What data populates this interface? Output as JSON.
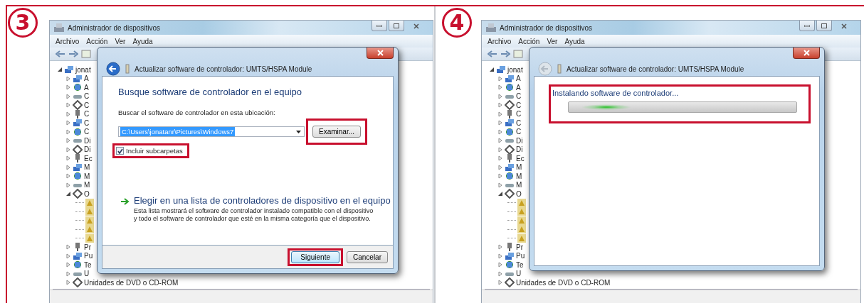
{
  "steps": [
    {
      "number": "3",
      "window": {
        "title": "Administrador de dispositivos",
        "menu": [
          "Archivo",
          "Acción",
          "Ver",
          "Ayuda"
        ],
        "tree": [
          {
            "label": "jonat",
            "expanded": true,
            "children": [
              {
                "label": "A",
                "expanded": false
              },
              {
                "label": "A",
                "expanded": false
              },
              {
                "label": "C",
                "expanded": false
              },
              {
                "label": "C",
                "expanded": false
              },
              {
                "label": "C",
                "expanded": false
              },
              {
                "label": "C",
                "expanded": false
              },
              {
                "label": "C",
                "expanded": false
              },
              {
                "label": "Di",
                "expanded": false
              },
              {
                "label": "Di",
                "expanded": false
              },
              {
                "label": "Ec",
                "expanded": false
              },
              {
                "label": "M",
                "expanded": false
              },
              {
                "label": "M",
                "expanded": false
              },
              {
                "label": "M",
                "expanded": false
              },
              {
                "label": "O",
                "expanded": true,
                "children": [
                  {
                    "kind": "unnamed"
                  },
                  {
                    "kind": "unnamed"
                  },
                  {
                    "kind": "unnamed"
                  },
                  {
                    "kind": "unnamed"
                  },
                  {
                    "kind": "unnamed"
                  }
                ]
              },
              {
                "label": "Pr",
                "expanded": false
              },
              {
                "label": "Pu",
                "expanded": false
              },
              {
                "label": "Te",
                "expanded": false
              },
              {
                "label": "U",
                "expanded": false
              },
              {
                "label": "Unidades de DVD o CD-ROM",
                "expanded": false
              }
            ]
          }
        ]
      },
      "dialog": {
        "kind": "browse",
        "back_enabled": true,
        "title": "Actualizar software de controlador: UMTS/HSPA Module",
        "heading": "Busque software de controlador en el equipo",
        "location_label": "Buscar el software de controlador en esta ubicación:",
        "location": {
          "value": "C:\\Users\\jonatanr\\Pictures\\Windows7",
          "text_selected": true
        },
        "browse_button": {
          "label": "Examinar...",
          "highlighted": true
        },
        "checkbox": {
          "label": "Incluir subcarpetas",
          "checked": true,
          "highlighted": true
        },
        "option": {
          "title": "Elegir en una lista de controladores de dispositivo en el equipo",
          "description": "Esta lista mostrará el software de controlador instalado compatible con el dispositivo y todo el software de controlador que esté en la misma categoría que el dispositivo."
        },
        "buttons": [
          {
            "label": "Siguiente",
            "highlighted": true,
            "default": true
          },
          {
            "label": "Cancelar",
            "highlighted": false,
            "default": false
          }
        ]
      }
    },
    {
      "number": "4",
      "window": {
        "title": "Administrador de dispositivos",
        "menu": [
          "Archivo",
          "Acción",
          "Ver",
          "Ayuda"
        ],
        "tree": [
          {
            "label": "jonat",
            "expanded": true,
            "children": [
              {
                "label": "A",
                "expanded": false
              },
              {
                "label": "A",
                "expanded": false
              },
              {
                "label": "C",
                "expanded": false
              },
              {
                "label": "C",
                "expanded": false
              },
              {
                "label": "C",
                "expanded": false
              },
              {
                "label": "C",
                "expanded": false
              },
              {
                "label": "C",
                "expanded": false
              },
              {
                "label": "Di",
                "expanded": false
              },
              {
                "label": "Di",
                "expanded": false
              },
              {
                "label": "Ec",
                "expanded": false
              },
              {
                "label": "M",
                "expanded": false
              },
              {
                "label": "M",
                "expanded": false
              },
              {
                "label": "M",
                "expanded": false
              },
              {
                "label": "O",
                "expanded": true,
                "children": [
                  {
                    "kind": "unnamed"
                  },
                  {
                    "kind": "unnamed"
                  },
                  {
                    "kind": "unnamed"
                  },
                  {
                    "kind": "unnamed"
                  },
                  {
                    "kind": "unnamed"
                  }
                ]
              },
              {
                "label": "Pr",
                "expanded": false
              },
              {
                "label": "Pu",
                "expanded": false
              },
              {
                "label": "Te",
                "expanded": false
              },
              {
                "label": "U",
                "expanded": false
              },
              {
                "label": "Unidades de DVD o CD-ROM",
                "expanded": false
              }
            ]
          }
        ]
      },
      "dialog": {
        "kind": "installing",
        "back_enabled": false,
        "title": "Actualizar software de controlador: UMTS/HSPA Module",
        "status": {
          "label": "Instalando software de controlador...",
          "highlighted": true
        }
      }
    }
  ]
}
